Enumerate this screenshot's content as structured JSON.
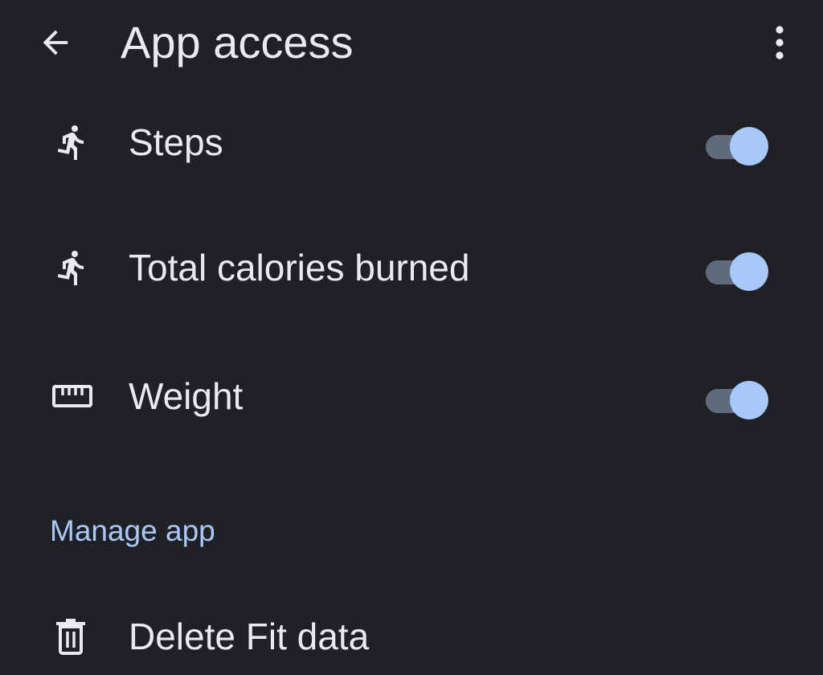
{
  "header": {
    "title": "App access",
    "back_icon": "arrow-back-icon",
    "more_icon": "more-vert-icon"
  },
  "permissions": [
    {
      "label": "Steps",
      "icon": "directions-run-icon",
      "enabled": true
    },
    {
      "label": "Total calories burned",
      "icon": "directions-run-icon",
      "enabled": true
    },
    {
      "label": "Weight",
      "icon": "straighten-ruler-icon",
      "enabled": true
    }
  ],
  "manage": {
    "section_title": "Manage app",
    "delete_label": "Delete Fit data",
    "delete_icon": "delete-trash-icon"
  },
  "colors": {
    "background": "#202124",
    "text": "#e8eaed",
    "accent": "#a8c7fa",
    "toggle_track": "#5f6b7c"
  }
}
